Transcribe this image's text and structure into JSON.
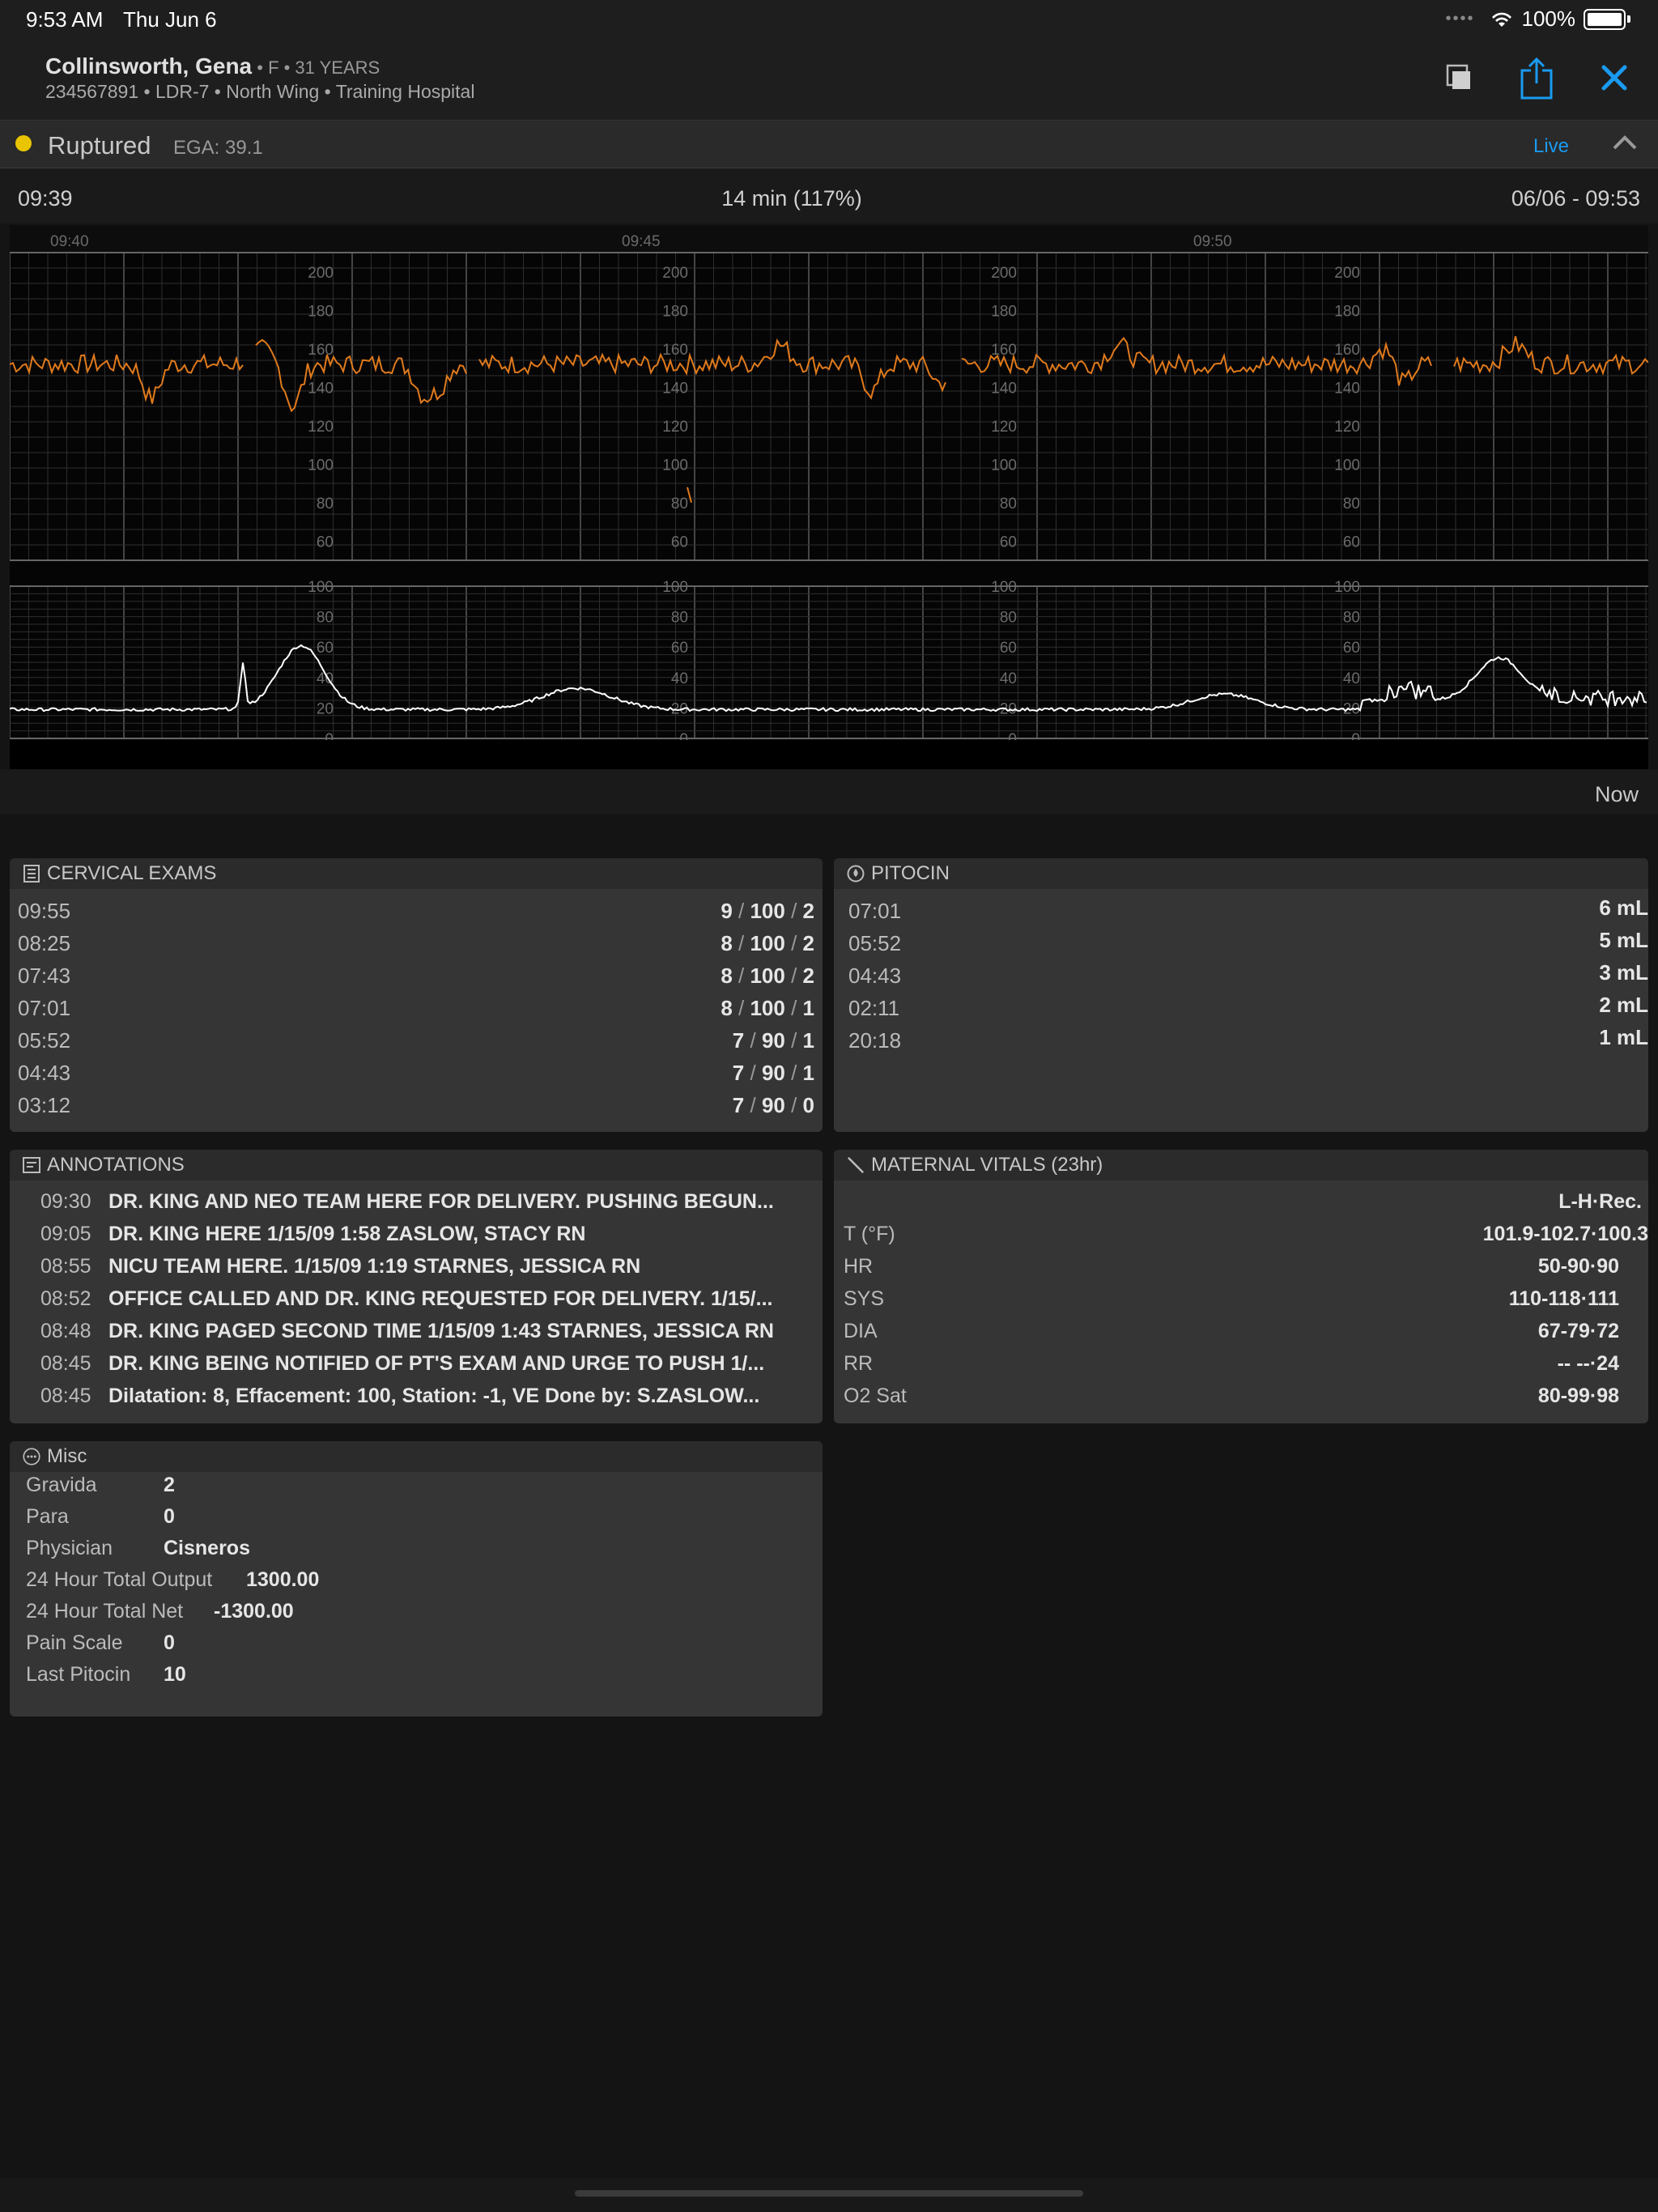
{
  "statusbar": {
    "time": "9:53 AM",
    "date": "Thu Jun 6",
    "battery": "100%"
  },
  "patient": {
    "name": "Collinsworth, Gena",
    "demographics": " • F • 31 YEARS",
    "meta": "234567891 • LDR-7 • North Wing • Training Hospital"
  },
  "status": {
    "label": "Ruptured",
    "ega": "EGA: 39.1",
    "live": "Live",
    "dot_color": "#e8c500"
  },
  "strip": {
    "start_time": "09:39",
    "duration": "14 min (117%)",
    "end_time": "06/06 - 09:53",
    "time_marks": [
      "09:40",
      "09:45",
      "09:50"
    ],
    "fhr_labels": [
      "200",
      "180",
      "160",
      "140",
      "120",
      "100",
      "80",
      "60"
    ],
    "toco_labels": [
      "100",
      "80",
      "60",
      "40",
      "20",
      "0"
    ],
    "now_label": "Now",
    "fhr_color": "#e07a1c",
    "toco_color": "#ffffff"
  },
  "cervical": {
    "title": "CERVICAL EXAMS",
    "rows": [
      {
        "time": "09:55",
        "dil": "9",
        "eff": "100",
        "sta": "2"
      },
      {
        "time": "08:25",
        "dil": "8",
        "eff": "100",
        "sta": "2"
      },
      {
        "time": "07:43",
        "dil": "8",
        "eff": "100",
        "sta": "2"
      },
      {
        "time": "07:01",
        "dil": "8",
        "eff": "100",
        "sta": "1"
      },
      {
        "time": "05:52",
        "dil": "7",
        "eff": "90",
        "sta": "1"
      },
      {
        "time": "04:43",
        "dil": "7",
        "eff": "90",
        "sta": "1"
      },
      {
        "time": "03:12",
        "dil": "7",
        "eff": "90",
        "sta": "0"
      }
    ]
  },
  "pitocin": {
    "title": "PITOCIN",
    "rows": [
      {
        "time": "07:01",
        "value": "6 mL"
      },
      {
        "time": "05:52",
        "value": "5 mL"
      },
      {
        "time": "04:43",
        "value": "3 mL"
      },
      {
        "time": "02:11",
        "value": "2 mL"
      },
      {
        "time": "20:18",
        "value": "1 mL"
      }
    ]
  },
  "annotations": {
    "title": "ANNOTATIONS",
    "rows": [
      {
        "time": "09:30",
        "text": "DR. KING AND NEO TEAM HERE FOR DELIVERY. PUSHING BEGUN..."
      },
      {
        "time": "09:05",
        "text": "DR. KING HERE 1/15/09 1:58 ZASLOW, STACY RN"
      },
      {
        "time": "08:55",
        "text": "NICU TEAM HERE. 1/15/09 1:19 STARNES, JESSICA RN"
      },
      {
        "time": "08:52",
        "text": "OFFICE CALLED AND DR. KING REQUESTED FOR DELIVERY. 1/15/..."
      },
      {
        "time": "08:48",
        "text": "DR. KING PAGED SECOND TIME 1/15/09 1:43 STARNES, JESSICA RN"
      },
      {
        "time": "08:45",
        "text": "DR. KING BEING NOTIFIED OF PT'S EXAM AND URGE TO PUSH 1/..."
      },
      {
        "time": "08:45",
        "text": "Dilatation: 8, Effacement: 100, Station: -1, VE Done by: S.ZASLOW..."
      }
    ]
  },
  "vitals": {
    "title": "MATERNAL VITALS (23hr)",
    "header": "L-H·Rec.",
    "rows": [
      {
        "label": "T (°F)",
        "value": "101.9-102.7·100.3"
      },
      {
        "label": "HR",
        "value": "50-90·90"
      },
      {
        "label": "SYS",
        "value": "110-118·111"
      },
      {
        "label": "DIA",
        "value": "67-79·72"
      },
      {
        "label": "RR",
        "value": "-- --·24"
      },
      {
        "label": "O2 Sat",
        "value": "80-99·98"
      }
    ]
  },
  "misc": {
    "title": "Misc",
    "rows": [
      {
        "label": "Gravida",
        "value": "2"
      },
      {
        "label": "Para",
        "value": "0"
      },
      {
        "label": "Physician",
        "value": "Cisneros"
      },
      {
        "label": "24 Hour Total Output",
        "value": "1300.00"
      },
      {
        "label": "24 Hour Total Net",
        "value": "-1300.00"
      },
      {
        "label": "Pain Scale",
        "value": "0"
      },
      {
        "label": "Last Pitocin",
        "value": "10"
      }
    ]
  }
}
